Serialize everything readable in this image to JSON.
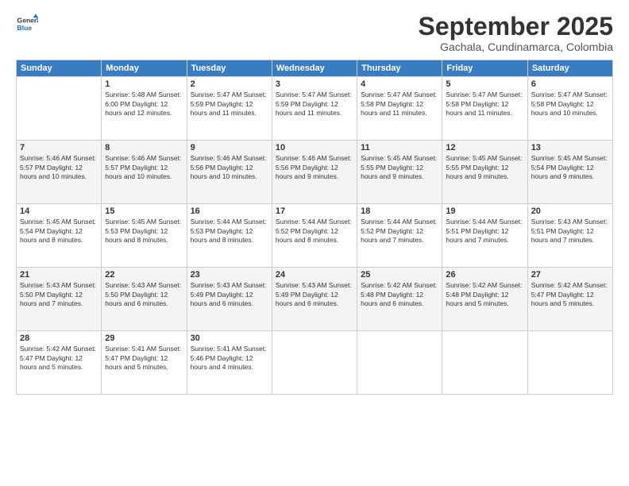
{
  "logo": {
    "line1": "General",
    "line2": "Blue"
  },
  "title": "September 2025",
  "subtitle": "Gachala, Cundinamarca, Colombia",
  "headers": [
    "Sunday",
    "Monday",
    "Tuesday",
    "Wednesday",
    "Thursday",
    "Friday",
    "Saturday"
  ],
  "weeks": [
    [
      {
        "day": "",
        "info": ""
      },
      {
        "day": "1",
        "info": "Sunrise: 5:48 AM\nSunset: 6:00 PM\nDaylight: 12 hours\nand 12 minutes."
      },
      {
        "day": "2",
        "info": "Sunrise: 5:47 AM\nSunset: 5:59 PM\nDaylight: 12 hours\nand 11 minutes."
      },
      {
        "day": "3",
        "info": "Sunrise: 5:47 AM\nSunset: 5:59 PM\nDaylight: 12 hours\nand 11 minutes."
      },
      {
        "day": "4",
        "info": "Sunrise: 5:47 AM\nSunset: 5:58 PM\nDaylight: 12 hours\nand 11 minutes."
      },
      {
        "day": "5",
        "info": "Sunrise: 5:47 AM\nSunset: 5:58 PM\nDaylight: 12 hours\nand 11 minutes."
      },
      {
        "day": "6",
        "info": "Sunrise: 5:47 AM\nSunset: 5:58 PM\nDaylight: 12 hours\nand 10 minutes."
      }
    ],
    [
      {
        "day": "7",
        "info": "Sunrise: 5:46 AM\nSunset: 5:57 PM\nDaylight: 12 hours\nand 10 minutes."
      },
      {
        "day": "8",
        "info": "Sunrise: 5:46 AM\nSunset: 5:57 PM\nDaylight: 12 hours\nand 10 minutes."
      },
      {
        "day": "9",
        "info": "Sunrise: 5:46 AM\nSunset: 5:56 PM\nDaylight: 12 hours\nand 10 minutes."
      },
      {
        "day": "10",
        "info": "Sunrise: 5:46 AM\nSunset: 5:56 PM\nDaylight: 12 hours\nand 9 minutes."
      },
      {
        "day": "11",
        "info": "Sunrise: 5:45 AM\nSunset: 5:55 PM\nDaylight: 12 hours\nand 9 minutes."
      },
      {
        "day": "12",
        "info": "Sunrise: 5:45 AM\nSunset: 5:55 PM\nDaylight: 12 hours\nand 9 minutes."
      },
      {
        "day": "13",
        "info": "Sunrise: 5:45 AM\nSunset: 5:54 PM\nDaylight: 12 hours\nand 9 minutes."
      }
    ],
    [
      {
        "day": "14",
        "info": "Sunrise: 5:45 AM\nSunset: 5:54 PM\nDaylight: 12 hours\nand 8 minutes."
      },
      {
        "day": "15",
        "info": "Sunrise: 5:45 AM\nSunset: 5:53 PM\nDaylight: 12 hours\nand 8 minutes."
      },
      {
        "day": "16",
        "info": "Sunrise: 5:44 AM\nSunset: 5:53 PM\nDaylight: 12 hours\nand 8 minutes."
      },
      {
        "day": "17",
        "info": "Sunrise: 5:44 AM\nSunset: 5:52 PM\nDaylight: 12 hours\nand 8 minutes."
      },
      {
        "day": "18",
        "info": "Sunrise: 5:44 AM\nSunset: 5:52 PM\nDaylight: 12 hours\nand 7 minutes."
      },
      {
        "day": "19",
        "info": "Sunrise: 5:44 AM\nSunset: 5:51 PM\nDaylight: 12 hours\nand 7 minutes."
      },
      {
        "day": "20",
        "info": "Sunrise: 5:43 AM\nSunset: 5:51 PM\nDaylight: 12 hours\nand 7 minutes."
      }
    ],
    [
      {
        "day": "21",
        "info": "Sunrise: 5:43 AM\nSunset: 5:50 PM\nDaylight: 12 hours\nand 7 minutes."
      },
      {
        "day": "22",
        "info": "Sunrise: 5:43 AM\nSunset: 5:50 PM\nDaylight: 12 hours\nand 6 minutes."
      },
      {
        "day": "23",
        "info": "Sunrise: 5:43 AM\nSunset: 5:49 PM\nDaylight: 12 hours\nand 6 minutes."
      },
      {
        "day": "24",
        "info": "Sunrise: 5:43 AM\nSunset: 5:49 PM\nDaylight: 12 hours\nand 6 minutes."
      },
      {
        "day": "25",
        "info": "Sunrise: 5:42 AM\nSunset: 5:48 PM\nDaylight: 12 hours\nand 6 minutes."
      },
      {
        "day": "26",
        "info": "Sunrise: 5:42 AM\nSunset: 5:48 PM\nDaylight: 12 hours\nand 5 minutes."
      },
      {
        "day": "27",
        "info": "Sunrise: 5:42 AM\nSunset: 5:47 PM\nDaylight: 12 hours\nand 5 minutes."
      }
    ],
    [
      {
        "day": "28",
        "info": "Sunrise: 5:42 AM\nSunset: 5:47 PM\nDaylight: 12 hours\nand 5 minutes."
      },
      {
        "day": "29",
        "info": "Sunrise: 5:41 AM\nSunset: 5:47 PM\nDaylight: 12 hours\nand 5 minutes."
      },
      {
        "day": "30",
        "info": "Sunrise: 5:41 AM\nSunset: 5:46 PM\nDaylight: 12 hours\nand 4 minutes."
      },
      {
        "day": "",
        "info": ""
      },
      {
        "day": "",
        "info": ""
      },
      {
        "day": "",
        "info": ""
      },
      {
        "day": "",
        "info": ""
      }
    ]
  ]
}
